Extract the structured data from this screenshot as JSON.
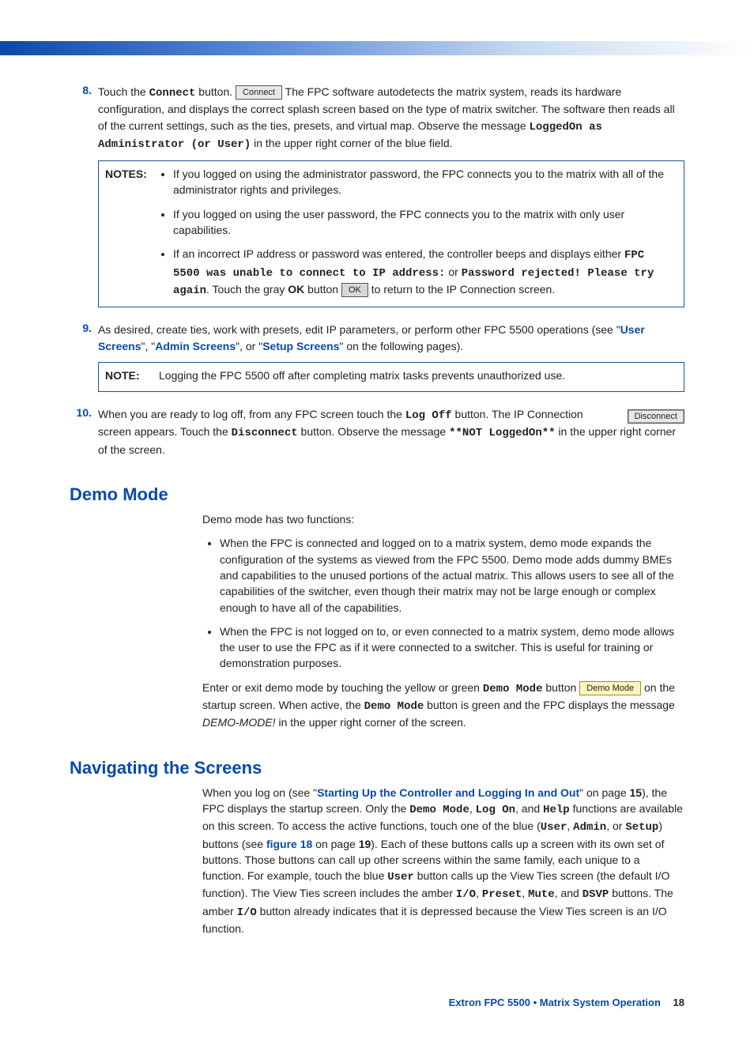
{
  "step8": {
    "num": "8.",
    "t1": "Touch the ",
    "connectWord": "Connect",
    "t2": " button. ",
    "connectBtn": "Connect",
    "t3": " The FPC software autodetects the matrix system, reads its hardware configuration, and displays the correct splash screen based on the type of matrix switcher. The software then reads all of the current settings, such as the ties, presets, and virtual map. Observe the message ",
    "mono1": "LoggedOn as Administrator (or User)",
    "t4": " in the upper right corner of the blue field."
  },
  "notes1": {
    "label": "NOTES:",
    "li1": "If you logged on using the administrator password, the FPC connects you to the matrix with all of the administrator rights and privileges.",
    "li2": "If you logged on using the user password, the FPC connects you to the matrix with only user capabilities.",
    "li3a": "If an incorrect IP address or password was entered, the controller beeps and displays either ",
    "li3m1": "FPC 5500 was unable to connect to IP address:",
    "li3b": " or ",
    "li3m2": "Password rejected! Please try again",
    "li3c": ". Touch the gray ",
    "li3ok": "OK",
    "li3d": " button ",
    "okBtn": "OK",
    "li3e": " to return to the IP Connection screen."
  },
  "step9": {
    "num": "9.",
    "t1": "As desired, create ties, work with presets, edit IP parameters, or perform other FPC 5500 operations (see \"",
    "l1": "User Screens",
    "t2": "\", \"",
    "l2": "Admin Screens",
    "t3": "\", or \"",
    "l3": "Setup Screens",
    "t4": "\" on the following pages)."
  },
  "note2": {
    "label": "NOTE:",
    "text": "Logging the FPC 5500 off after completing matrix tasks prevents unauthorized use."
  },
  "step10": {
    "num": "10.",
    "t1": "When you are ready to log off, from any FPC screen touch the ",
    "m1": "Log Off",
    "t2": " button. The IP Connection screen appears. Touch the ",
    "m2": "Disconnect",
    "t3": " button. Observe the message ",
    "m3": "**NOT LoggedOn**",
    "t4": " in the upper right corner of the screen.",
    "disconnectBtn": "Disconnect"
  },
  "demo": {
    "heading": "Demo Mode",
    "intro": "Demo mode has two functions:",
    "li1": "When the FPC is connected and logged on to a matrix system, demo mode expands the configuration of the systems as viewed from the FPC 5500. Demo mode adds dummy BMEs and capabilities to the unused portions of the actual matrix. This allows users to see all of the capabilities of the switcher, even though their matrix may not be large enough or complex enough to have all of the capabilities.",
    "li2": "When the FPC is not logged on to, or even connected to a matrix system, demo mode allows the user to use the FPC as if it were connected to a switcher. This is useful for training or demonstration purposes.",
    "p2a": "Enter or exit demo mode by touching the yellow or green ",
    "p2m1": "Demo Mode",
    "p2b": " button ",
    "demoBtn": "Demo Mode",
    "p2c": " on the startup screen. When active, the ",
    "p2m2": "Demo Mode",
    "p2d": " button is green and the FPC displays the message ",
    "p2i": "DEMO-MODE!",
    "p2e": " in the upper right corner of the screen."
  },
  "nav": {
    "heading": "Navigating the Screens",
    "t1": "When you log on (see \"",
    "l1": "Starting Up the Controller and Logging In and Out",
    "t2": "\" on page ",
    "pg1": "15",
    "t3": "), the FPC displays the startup screen. Only the ",
    "m1": "Demo Mode",
    "t4": ", ",
    "m2": "Log On",
    "t5": ", and ",
    "m3": "Help",
    "t6": " functions are available on this screen. To access the active functions, touch one of the blue (",
    "m4": "User",
    "t7": ", ",
    "m5": "Admin",
    "t8": ", or ",
    "m6": "Setup",
    "t9": ") buttons (see ",
    "l2": "figure 18",
    "t10": " on page ",
    "pg2": "19",
    "t11": "). Each of these buttons calls up a screen with its own set of buttons. Those buttons can call up other screens within the same family, each unique to a function. For example, touch the blue ",
    "m7": "User",
    "t12": " button calls up the View Ties screen (the default I/O function). The View Ties screen includes the amber ",
    "m8": "I/O",
    "t13": ", ",
    "m9": "Preset",
    "t14": ", ",
    "m10": "Mute",
    "t15": ", and ",
    "m11": "DSVP",
    "t16": " buttons. The amber ",
    "m12": "I/O",
    "t17": " button already indicates that it is depressed because the View Ties screen is an I/O function."
  },
  "footer": {
    "text": "Extron FPC 5500 • Matrix System Operation",
    "page": "18"
  }
}
